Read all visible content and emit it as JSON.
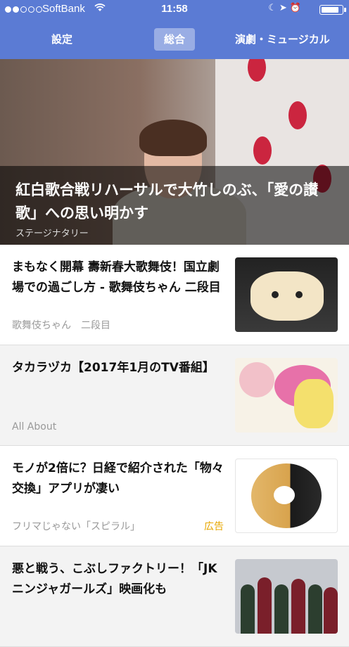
{
  "status_bar": {
    "carrier": "SoftBank",
    "time": "11:58"
  },
  "tabs": [
    {
      "label": "設定"
    },
    {
      "label": "総合",
      "selected": true
    },
    {
      "label": "演劇・ミュージカル"
    }
  ],
  "hero": {
    "title": "紅白歌合戦リハーサルで大竹しのぶ、「愛の讃歌」への思い明かす",
    "source": "ステージナタリー"
  },
  "articles": [
    {
      "title": "まもなく開幕 壽新春大歌舞伎！国立劇場での過ごし方 - 歌舞伎ちゃん 二段目",
      "source": "歌舞伎ちゃん　二段目"
    },
    {
      "title": "タカラヅカ【2017年1月のTV番組】",
      "source": "All About"
    },
    {
      "title": "モノが2倍に？日経で紹介された「物々交換」アプリが凄い",
      "source": "フリマじゃない「スピラル」",
      "badge": "広告"
    },
    {
      "title": "悪と戦う、こぶしファクトリー！「JKニンジャガールズ」映画化も",
      "source": ""
    }
  ],
  "colors": {
    "header_bg": "#5b7bd4",
    "ad_badge": "#e7a700"
  }
}
